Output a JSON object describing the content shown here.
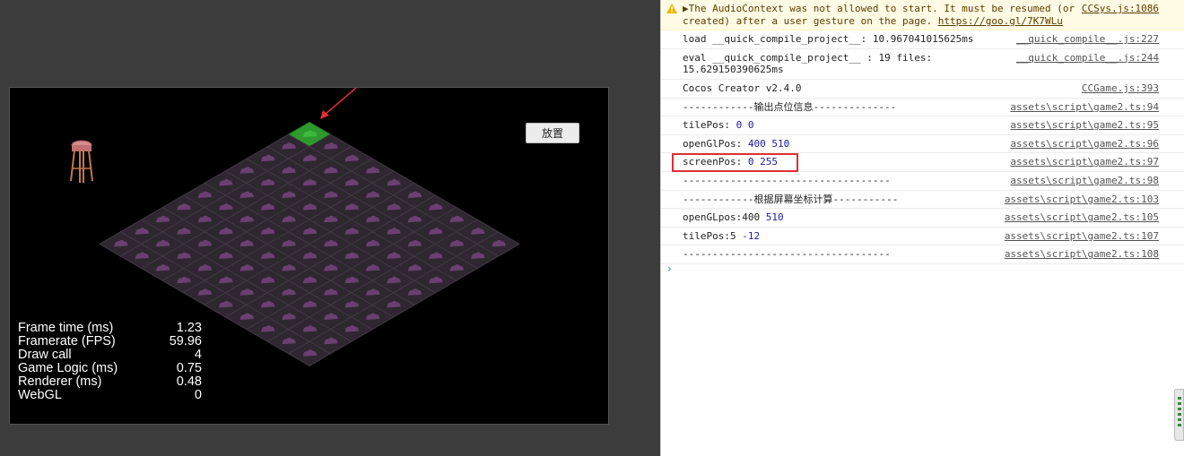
{
  "game": {
    "place_button_label": "放置",
    "stats": [
      {
        "label": "Frame time (ms)",
        "value": "1.23"
      },
      {
        "label": "Framerate (FPS)",
        "value": "59.96"
      },
      {
        "label": "Draw call",
        "value": "4"
      },
      {
        "label": "Game Logic (ms)",
        "value": "0.75"
      },
      {
        "label": "Renderer (ms)",
        "value": "0.48"
      },
      {
        "label": "WebGL",
        "value": "0"
      }
    ],
    "colors": {
      "tile_fill": "#2e2730",
      "tile_icon": "#6b3f72",
      "selected_tile": "#2e9a2e",
      "arrow": "#e03030"
    }
  },
  "console": {
    "warning": {
      "line1": "▶The AudioContext was not allowed to start. It must be resumed (or",
      "line2_text": "created) after a user gesture on the page. ",
      "link": "https://goo.gl/7K7WLu",
      "source": "CCSys.js:1086"
    },
    "rows": [
      {
        "text": "load __quick_compile_project__: 10.967041015625ms",
        "source": "__quick_compile__.js:227"
      },
      {
        "text": "eval __quick_compile_project__ : 19 files:",
        "text2": "15.629150390625ms",
        "source": "__quick_compile__.js:244"
      },
      {
        "text": "Cocos Creator v2.4.0",
        "source": "CCGame.js:393"
      },
      {
        "text": "------------输出点位信息--------------",
        "source": "assets\\script\\game2.ts:94"
      },
      {
        "label": "tilePos: ",
        "value": "0 0",
        "source": "assets\\script\\game2.ts:95"
      },
      {
        "label": "openGlPos: ",
        "value": "400 510",
        "source": "assets\\script\\game2.ts:96"
      },
      {
        "label": "screenPos: ",
        "value": "0 255",
        "source": "assets\\script\\game2.ts:97"
      },
      {
        "text": "-----------------------------------",
        "source": "assets\\script\\game2.ts:98"
      },
      {
        "text": "------------根据屏幕坐标计算-----------",
        "source": "assets\\script\\game2.ts:103"
      },
      {
        "label": "openGLpos:400 ",
        "value": "510",
        "source": "assets\\script\\game2.ts:105"
      },
      {
        "label": "tilePos:5 ",
        "value": "-12",
        "source": "assets\\script\\game2.ts:107"
      },
      {
        "text": "-----------------------------------",
        "source": "assets\\script\\game2.ts:108"
      }
    ],
    "prompt": "›"
  }
}
